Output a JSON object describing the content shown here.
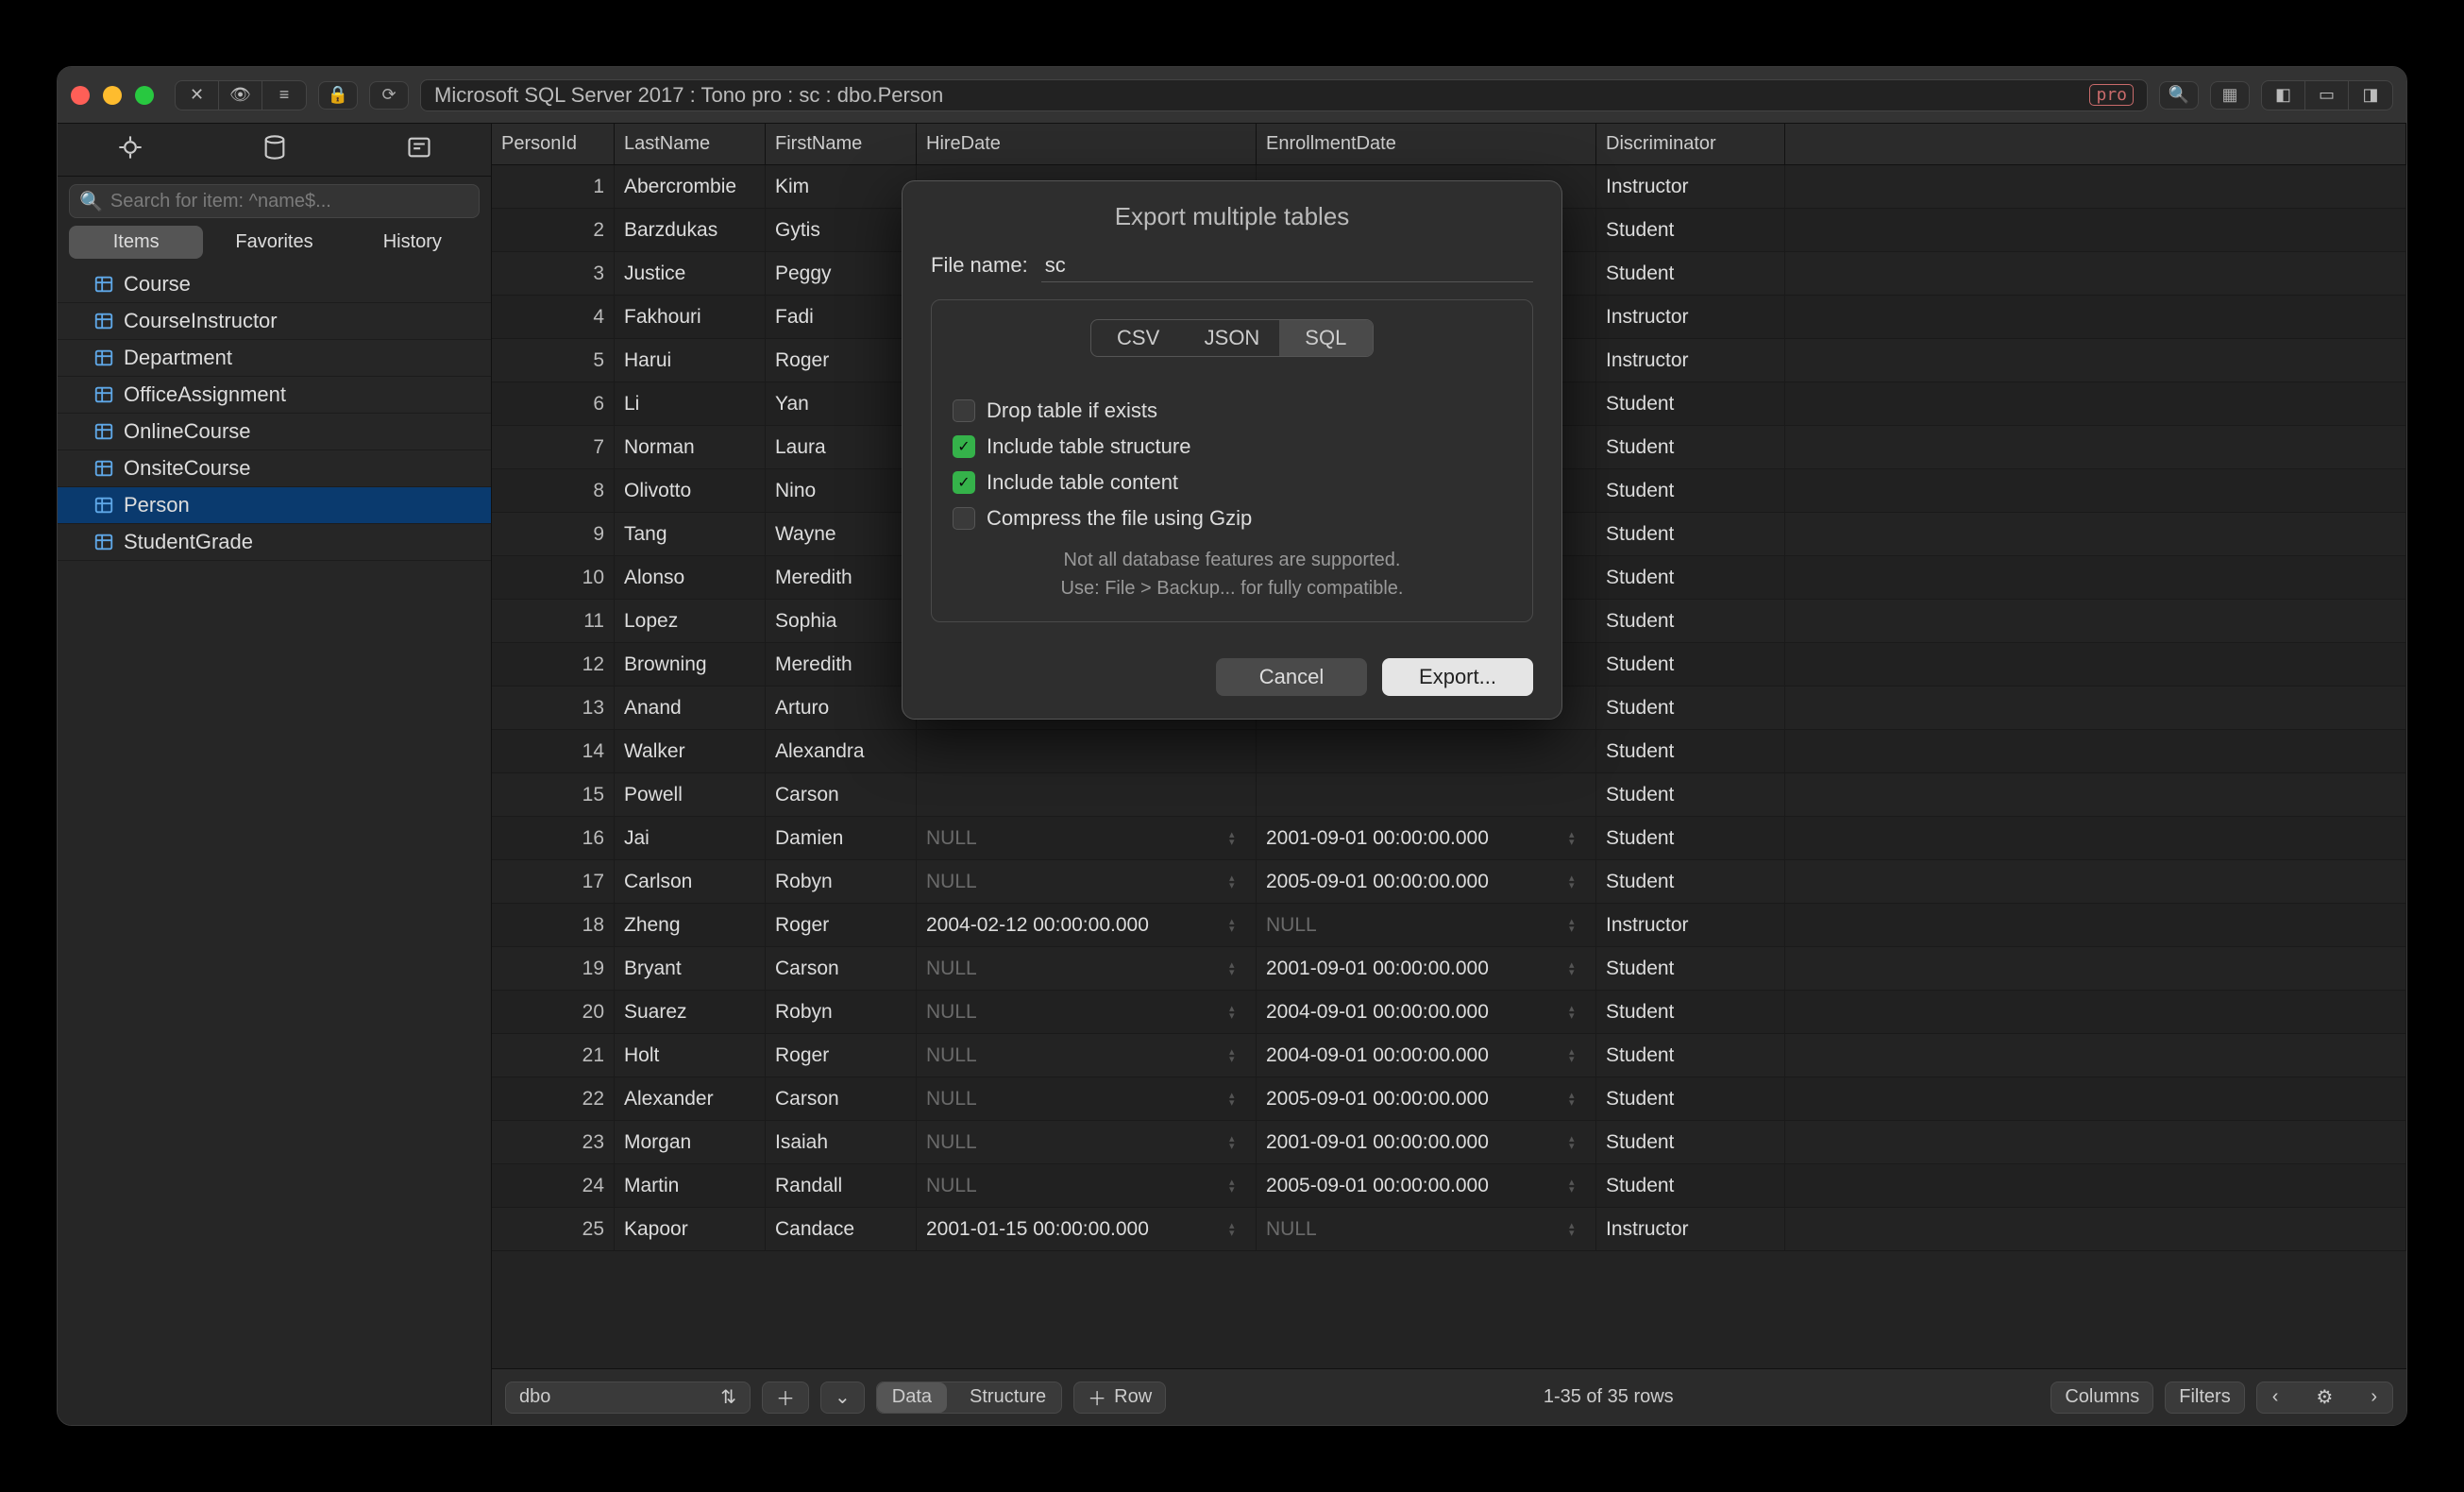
{
  "titlebar": {
    "path": "Microsoft SQL Server 2017 : Tono pro : sc : dbo.Person",
    "pro_badge": "pro"
  },
  "sidebar": {
    "search_placeholder": "Search for item: ^name$...",
    "tabs": {
      "items": "Items",
      "favorites": "Favorites",
      "history": "History"
    },
    "tables": [
      {
        "name": "Course",
        "sel": false
      },
      {
        "name": "CourseInstructor",
        "sel": false
      },
      {
        "name": "Department",
        "sel": false
      },
      {
        "name": "OfficeAssignment",
        "sel": false
      },
      {
        "name": "OnlineCourse",
        "sel": false
      },
      {
        "name": "OnsiteCourse",
        "sel": false
      },
      {
        "name": "Person",
        "sel": true
      },
      {
        "name": "StudentGrade",
        "sel": false
      }
    ]
  },
  "columns": [
    "PersonId",
    "LastName",
    "FirstName",
    "HireDate",
    "EnrollmentDate",
    "Discriminator"
  ],
  "rows": [
    {
      "id": 1,
      "last": "Abercrombie",
      "first": "Kim",
      "hire": "",
      "enroll": "",
      "disc": "Instructor"
    },
    {
      "id": 2,
      "last": "Barzdukas",
      "first": "Gytis",
      "hire": "",
      "enroll": "",
      "disc": "Student"
    },
    {
      "id": 3,
      "last": "Justice",
      "first": "Peggy",
      "hire": "",
      "enroll": "",
      "disc": "Student"
    },
    {
      "id": 4,
      "last": "Fakhouri",
      "first": "Fadi",
      "hire": "",
      "enroll": "",
      "disc": "Instructor"
    },
    {
      "id": 5,
      "last": "Harui",
      "first": "Roger",
      "hire": "",
      "enroll": "",
      "disc": "Instructor"
    },
    {
      "id": 6,
      "last": "Li",
      "first": "Yan",
      "hire": "",
      "enroll": "",
      "disc": "Student"
    },
    {
      "id": 7,
      "last": "Norman",
      "first": "Laura",
      "hire": "",
      "enroll": "",
      "disc": "Student"
    },
    {
      "id": 8,
      "last": "Olivotto",
      "first": "Nino",
      "hire": "",
      "enroll": "",
      "disc": "Student"
    },
    {
      "id": 9,
      "last": "Tang",
      "first": "Wayne",
      "hire": "",
      "enroll": "",
      "disc": "Student"
    },
    {
      "id": 10,
      "last": "Alonso",
      "first": "Meredith",
      "hire": "",
      "enroll": "",
      "disc": "Student"
    },
    {
      "id": 11,
      "last": "Lopez",
      "first": "Sophia",
      "hire": "",
      "enroll": "",
      "disc": "Student"
    },
    {
      "id": 12,
      "last": "Browning",
      "first": "Meredith",
      "hire": "",
      "enroll": "",
      "disc": "Student"
    },
    {
      "id": 13,
      "last": "Anand",
      "first": "Arturo",
      "hire": "",
      "enroll": "",
      "disc": "Student"
    },
    {
      "id": 14,
      "last": "Walker",
      "first": "Alexandra",
      "hire": "",
      "enroll": "",
      "disc": "Student"
    },
    {
      "id": 15,
      "last": "Powell",
      "first": "Carson",
      "hire": "",
      "enroll": "",
      "disc": "Student"
    },
    {
      "id": 16,
      "last": "Jai",
      "first": "Damien",
      "hire": "NULL",
      "enroll": "2001-09-01 00:00:00.000",
      "disc": "Student"
    },
    {
      "id": 17,
      "last": "Carlson",
      "first": "Robyn",
      "hire": "NULL",
      "enroll": "2005-09-01 00:00:00.000",
      "disc": "Student"
    },
    {
      "id": 18,
      "last": "Zheng",
      "first": "Roger",
      "hire": "2004-02-12 00:00:00.000",
      "enroll": "NULL",
      "disc": "Instructor"
    },
    {
      "id": 19,
      "last": "Bryant",
      "first": "Carson",
      "hire": "NULL",
      "enroll": "2001-09-01 00:00:00.000",
      "disc": "Student"
    },
    {
      "id": 20,
      "last": "Suarez",
      "first": "Robyn",
      "hire": "NULL",
      "enroll": "2004-09-01 00:00:00.000",
      "disc": "Student"
    },
    {
      "id": 21,
      "last": "Holt",
      "first": "Roger",
      "hire": "NULL",
      "enroll": "2004-09-01 00:00:00.000",
      "disc": "Student"
    },
    {
      "id": 22,
      "last": "Alexander",
      "first": "Carson",
      "hire": "NULL",
      "enroll": "2005-09-01 00:00:00.000",
      "disc": "Student"
    },
    {
      "id": 23,
      "last": "Morgan",
      "first": "Isaiah",
      "hire": "NULL",
      "enroll": "2001-09-01 00:00:00.000",
      "disc": "Student"
    },
    {
      "id": 24,
      "last": "Martin",
      "first": "Randall",
      "hire": "NULL",
      "enroll": "2005-09-01 00:00:00.000",
      "disc": "Student"
    },
    {
      "id": 25,
      "last": "Kapoor",
      "first": "Candace",
      "hire": "2001-01-15 00:00:00.000",
      "enroll": "NULL",
      "disc": "Instructor"
    }
  ],
  "footer": {
    "schema": "dbo",
    "view_data": "Data",
    "view_structure": "Structure",
    "add_row": "Row",
    "status": "1-35 of 35 rows",
    "columns_btn": "Columns",
    "filters_btn": "Filters"
  },
  "modal": {
    "title": "Export multiple tables",
    "file_label": "File name:",
    "file_value": "sc",
    "formats": {
      "csv": "CSV",
      "json": "JSON",
      "sql": "SQL",
      "active": "SQL"
    },
    "opts": {
      "drop": "Drop table if exists",
      "structure": "Include table structure",
      "content": "Include table content",
      "gzip": "Compress the file using Gzip"
    },
    "note1": "Not all database features are supported.",
    "note2": "Use: File > Backup... for fully compatible.",
    "cancel": "Cancel",
    "export": "Export..."
  }
}
